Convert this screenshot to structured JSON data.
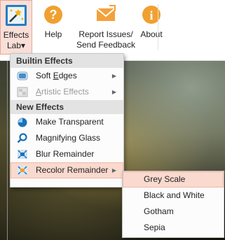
{
  "ribbon": {
    "buttons": [
      {
        "label_line1": "Effects",
        "label_line2": "Lab",
        "dropdown_arrow": "▾",
        "icon": "effects-lab-icon",
        "active": true
      },
      {
        "label_line1": "Help",
        "label_line2": "",
        "icon": "help-icon"
      },
      {
        "label_line1": "Report Issues/",
        "label_line2": "Send Feedback",
        "icon": "envelope-icon"
      },
      {
        "label_line1": "About",
        "label_line2": "",
        "icon": "info-icon"
      }
    ]
  },
  "menu": {
    "sections": [
      {
        "header": "Builtin Effects",
        "items": [
          {
            "label_pre": "Soft ",
            "label_u": "E",
            "label_post": "dges",
            "icon": "soft-edges-icon",
            "submenu": true,
            "disabled": false
          },
          {
            "label_pre": "",
            "label_u": "A",
            "label_post": "rtistic Effects",
            "icon": "artistic-effects-icon",
            "submenu": true,
            "disabled": true
          }
        ]
      },
      {
        "header": "New Effects",
        "items": [
          {
            "label": "Make Transparent",
            "icon": "make-transparent-icon"
          },
          {
            "label": "Magnifying Glass",
            "icon": "magnifying-glass-icon"
          },
          {
            "label": "Blur Remainder",
            "icon": "blur-remainder-icon"
          },
          {
            "label": "Recolor Remainder",
            "icon": "recolor-remainder-icon",
            "submenu": true,
            "highlighted": true
          }
        ]
      }
    ]
  },
  "submenu": {
    "items": [
      {
        "label": "Grey Scale",
        "highlighted": true
      },
      {
        "label": "Black and White"
      },
      {
        "label": "Gotham"
      },
      {
        "label": "Sepia"
      }
    ]
  },
  "glyphs": {
    "submenu_arrow": "▶"
  },
  "colors": {
    "accent": "#f9dfd8",
    "accent_border": "#e6a995",
    "icon_blue": "#1a73b8",
    "icon_orange": "#f0a030"
  }
}
